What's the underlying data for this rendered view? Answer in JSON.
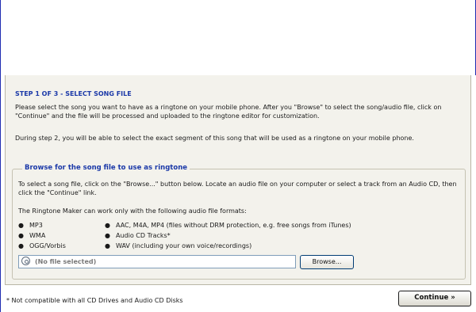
{
  "step": {
    "title": "STEP 1 OF 3 - SELECT SONG FILE",
    "intro": "Please select the song you want to have as a ringtone on your mobile phone. After you \"Browse\" to select the song/audio file, click on \"Continue\" and the file will be processed and uploaded to the ringtone editor for customization.",
    "intro2": "During step 2, you will be able to select the exact segment of this song that will be used as a ringtone on your mobile phone."
  },
  "browse_section": {
    "legend": "Browse for the song file to use as ringtone",
    "description": "To select a song file, click on the \"Browse...\" button below. Locate an audio file on your computer or select a track from an Audio CD, then click the \"Continue\" link.",
    "formats_intro": "The Ringtone Maker can work only with the following audio file formats:",
    "formats_col1": [
      "MP3",
      "WMA",
      "OGG/Vorbis"
    ],
    "formats_col2": [
      "AAC, M4A, MP4 (files without DRM protection, e.g. free songs from iTunes)",
      "Audio CD Tracks*",
      "WAV (including your own voice/recordings)"
    ],
    "file_field_value": "(No file selected)",
    "browse_button": "Browse..."
  },
  "footer": {
    "note": "* Not compatible with all CD Drives and Audio CD Disks",
    "continue_button": "Continue »"
  },
  "colors": {
    "accent": "#1b39a8",
    "panel_bg": "#f3f2ec",
    "frame": "#1f2db2"
  },
  "icons": {
    "file_field_icon": "disc-icon",
    "bullet": "bullet-icon"
  }
}
